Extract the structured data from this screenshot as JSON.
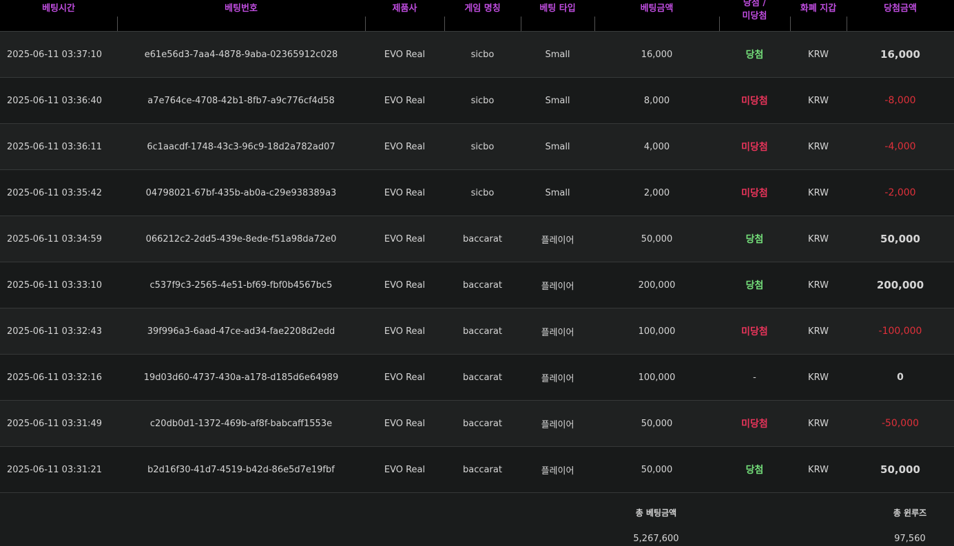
{
  "columns": [
    "베팅시간",
    "베팅번호",
    "제품사",
    "게임 명칭",
    "베팅 타입",
    "베팅금액",
    "당첨 /\n미당첨",
    "화폐 지갑",
    "당첨금액"
  ],
  "rows": [
    {
      "time": "2025-06-11 03:37:10",
      "id": "e61e56d3-7aa4-4878-9aba-02365912c028",
      "vendor": "EVO Real",
      "game": "sicbo",
      "type": "Small",
      "bet": "16,000",
      "result": "당첨",
      "result_kind": "win",
      "currency": "KRW",
      "payout": "16,000",
      "payout_kind": "pos"
    },
    {
      "time": "2025-06-11 03:36:40",
      "id": "a7e764ce-4708-42b1-8fb7-a9c776cf4d58",
      "vendor": "EVO Real",
      "game": "sicbo",
      "type": "Small",
      "bet": "8,000",
      "result": "미당첨",
      "result_kind": "lose",
      "currency": "KRW",
      "payout": "-8,000",
      "payout_kind": "neg"
    },
    {
      "time": "2025-06-11 03:36:11",
      "id": "6c1aacdf-1748-43c3-96c9-18d2a782ad07",
      "vendor": "EVO Real",
      "game": "sicbo",
      "type": "Small",
      "bet": "4,000",
      "result": "미당첨",
      "result_kind": "lose",
      "currency": "KRW",
      "payout": "-4,000",
      "payout_kind": "neg"
    },
    {
      "time": "2025-06-11 03:35:42",
      "id": "04798021-67bf-435b-ab0a-c29e938389a3",
      "vendor": "EVO Real",
      "game": "sicbo",
      "type": "Small",
      "bet": "2,000",
      "result": "미당첨",
      "result_kind": "lose",
      "currency": "KRW",
      "payout": "-2,000",
      "payout_kind": "neg"
    },
    {
      "time": "2025-06-11 03:34:59",
      "id": "066212c2-2dd5-439e-8ede-f51a98da72e0",
      "vendor": "EVO Real",
      "game": "baccarat",
      "type": "플레이어",
      "bet": "50,000",
      "result": "당첨",
      "result_kind": "win",
      "currency": "KRW",
      "payout": "50,000",
      "payout_kind": "pos"
    },
    {
      "time": "2025-06-11 03:33:10",
      "id": "c537f9c3-2565-4e51-bf69-fbf0b4567bc5",
      "vendor": "EVO Real",
      "game": "baccarat",
      "type": "플레이어",
      "bet": "200,000",
      "result": "당첨",
      "result_kind": "win",
      "currency": "KRW",
      "payout": "200,000",
      "payout_kind": "pos"
    },
    {
      "time": "2025-06-11 03:32:43",
      "id": "39f996a3-6aad-47ce-ad34-fae2208d2edd",
      "vendor": "EVO Real",
      "game": "baccarat",
      "type": "플레이어",
      "bet": "100,000",
      "result": "미당첨",
      "result_kind": "lose",
      "currency": "KRW",
      "payout": "-100,000",
      "payout_kind": "neg"
    },
    {
      "time": "2025-06-11 03:32:16",
      "id": "19d03d60-4737-430a-a178-d185d6e64989",
      "vendor": "EVO Real",
      "game": "baccarat",
      "type": "플레이어",
      "bet": "100,000",
      "result": "-",
      "result_kind": "none",
      "currency": "KRW",
      "payout": "0",
      "payout_kind": "zero"
    },
    {
      "time": "2025-06-11 03:31:49",
      "id": "c20db0d1-1372-469b-af8f-babcaff1553e",
      "vendor": "EVO Real",
      "game": "baccarat",
      "type": "플레이어",
      "bet": "50,000",
      "result": "미당첨",
      "result_kind": "lose",
      "currency": "KRW",
      "payout": "-50,000",
      "payout_kind": "neg"
    },
    {
      "time": "2025-06-11 03:31:21",
      "id": "b2d16f30-41d7-4519-b42d-86e5d7e19fbf",
      "vendor": "EVO Real",
      "game": "baccarat",
      "type": "플레이어",
      "bet": "50,000",
      "result": "당첨",
      "result_kind": "win",
      "currency": "KRW",
      "payout": "50,000",
      "payout_kind": "pos"
    }
  ],
  "summary": {
    "total_bet_label": "총 베팅금액",
    "total_bet_value": "5,267,600",
    "total_winloss_label": "총 윈루즈",
    "total_winloss_value": "97,560"
  },
  "colors": {
    "header_text": "#c04de0",
    "win": "#74df7a",
    "lose": "#e8345a",
    "negative_amount": "#e0303a"
  }
}
